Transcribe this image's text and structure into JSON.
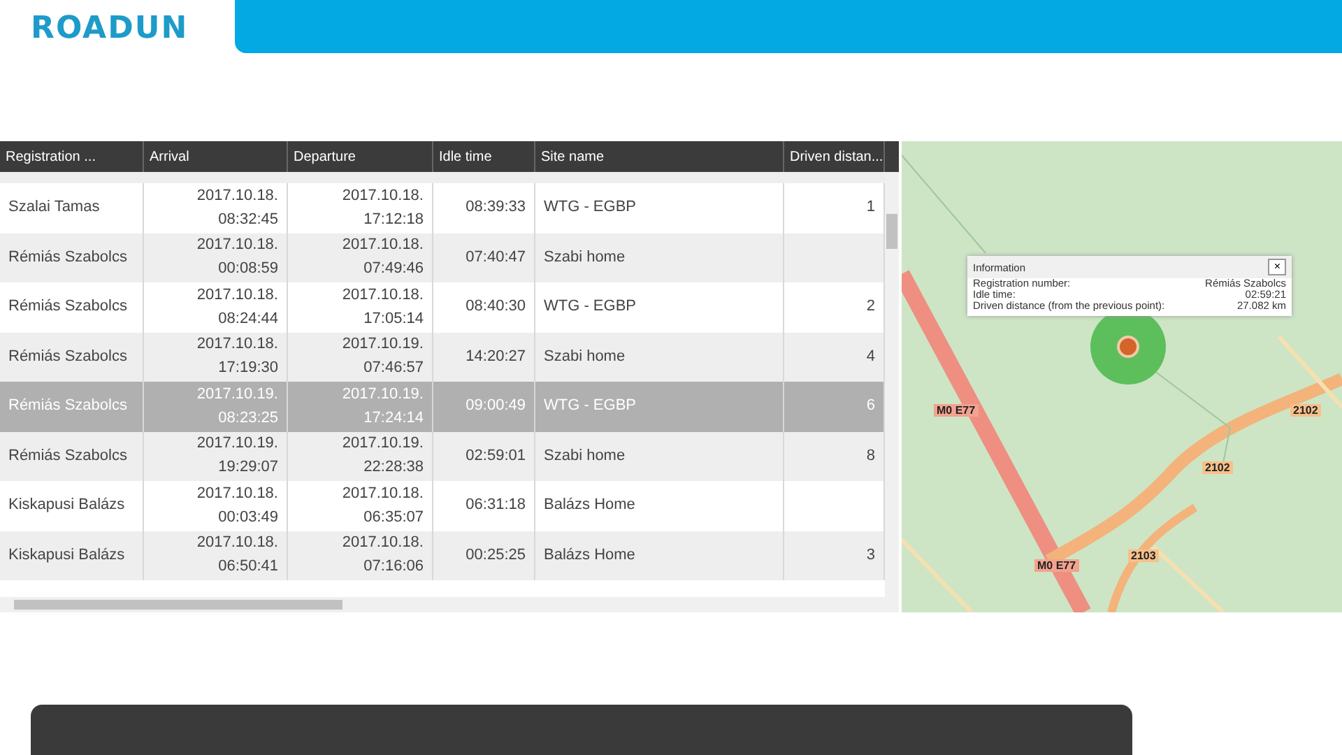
{
  "header": {
    "logo": "ROADUN"
  },
  "table": {
    "columns": [
      "Registration ...",
      "Arrival",
      "Departure",
      "Idle time",
      "Site name",
      "Driven distan..."
    ],
    "rows": [
      {
        "name": "Szalai Tamas",
        "arrival": [
          "2017.10.18.",
          "08:32:45"
        ],
        "departure": [
          "2017.10.18.",
          "17:12:18"
        ],
        "idle": "08:39:33",
        "site": "WTG - EGBP",
        "distance": "1",
        "selected": false
      },
      {
        "name": "Rémiás Szabolcs",
        "arrival": [
          "2017.10.18.",
          "00:08:59"
        ],
        "departure": [
          "2017.10.18.",
          "07:49:46"
        ],
        "idle": "07:40:47",
        "site": "Szabi home",
        "distance": "",
        "selected": false
      },
      {
        "name": "Rémiás Szabolcs",
        "arrival": [
          "2017.10.18.",
          "08:24:44"
        ],
        "departure": [
          "2017.10.18.",
          "17:05:14"
        ],
        "idle": "08:40:30",
        "site": "WTG - EGBP",
        "distance": "2",
        "selected": false
      },
      {
        "name": "Rémiás Szabolcs",
        "arrival": [
          "2017.10.18.",
          "17:19:30"
        ],
        "departure": [
          "2017.10.19.",
          "07:46:57"
        ],
        "idle": "14:20:27",
        "site": "Szabi home",
        "distance": "4",
        "selected": false
      },
      {
        "name": "Rémiás Szabolcs",
        "arrival": [
          "2017.10.19.",
          "08:23:25"
        ],
        "departure": [
          "2017.10.19.",
          "17:24:14"
        ],
        "idle": "09:00:49",
        "site": "WTG - EGBP",
        "distance": "6",
        "selected": true
      },
      {
        "name": "Rémiás Szabolcs",
        "arrival": [
          "2017.10.19.",
          "19:29:07"
        ],
        "departure": [
          "2017.10.19.",
          "22:28:38"
        ],
        "idle": "02:59:01",
        "site": "Szabi home",
        "distance": "8",
        "selected": false
      },
      {
        "name": "Kiskapusi Balázs",
        "arrival": [
          "2017.10.18.",
          "00:03:49"
        ],
        "departure": [
          "2017.10.18.",
          "06:35:07"
        ],
        "idle": "06:31:18",
        "site": "Balázs Home",
        "distance": "",
        "selected": false
      },
      {
        "name": "Kiskapusi Balázs",
        "arrival": [
          "2017.10.18.",
          "06:50:41"
        ],
        "departure": [
          "2017.10.18.",
          "07:16:06"
        ],
        "idle": "00:25:25",
        "site": "Balázs Home",
        "distance": "3",
        "selected": false
      }
    ]
  },
  "map": {
    "popup": {
      "title": "Information",
      "close": "×",
      "rows": [
        {
          "label": "Registration number:",
          "value": "Rémiás Szabolcs"
        },
        {
          "label": "Idle time:",
          "value": "02:59:21"
        },
        {
          "label": "Driven distance (from the previous point):",
          "value": "27.082 km"
        }
      ]
    },
    "road_labels": [
      {
        "text": "M0 E77",
        "kind": "motorway"
      },
      {
        "text": "2102",
        "kind": "main"
      },
      {
        "text": "2102",
        "kind": "main"
      },
      {
        "text": "M0 E77",
        "kind": "motorway"
      },
      {
        "text": "2103",
        "kind": "main"
      }
    ]
  }
}
